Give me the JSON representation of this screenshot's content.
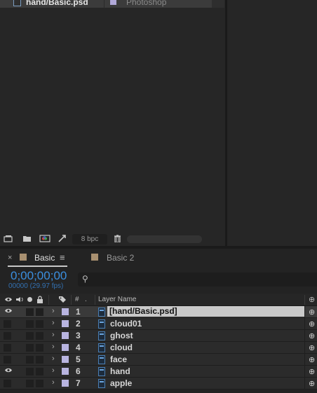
{
  "project": {
    "item_name": "hand/Basic.psd",
    "item_type": "Photoshop",
    "bpc": "8 bpc"
  },
  "timeline": {
    "tabs": [
      {
        "label": "Basic",
        "active": true
      },
      {
        "label": "Basic 2",
        "active": false
      }
    ],
    "timecode": "0;00;00;00",
    "frame_info": "00000 (29.97 fps)",
    "column_hash": "#",
    "column_layer_name": "Layer Name",
    "layers": [
      {
        "num": "1",
        "name": "[hand/Basic.psd]",
        "eye": true,
        "selected": true
      },
      {
        "num": "2",
        "name": "cloud01",
        "eye": false,
        "selected": false
      },
      {
        "num": "3",
        "name": "ghost",
        "eye": false,
        "selected": false
      },
      {
        "num": "4",
        "name": "cloud",
        "eye": false,
        "selected": false
      },
      {
        "num": "5",
        "name": "face",
        "eye": false,
        "selected": false
      },
      {
        "num": "6",
        "name": "hand",
        "eye": true,
        "selected": false
      },
      {
        "num": "7",
        "name": "apple",
        "eye": false,
        "selected": false
      }
    ]
  },
  "colors": {
    "accent": "#3b8ede",
    "label_lavender": "#b8b4e0",
    "comp_tab": "#a89070"
  }
}
